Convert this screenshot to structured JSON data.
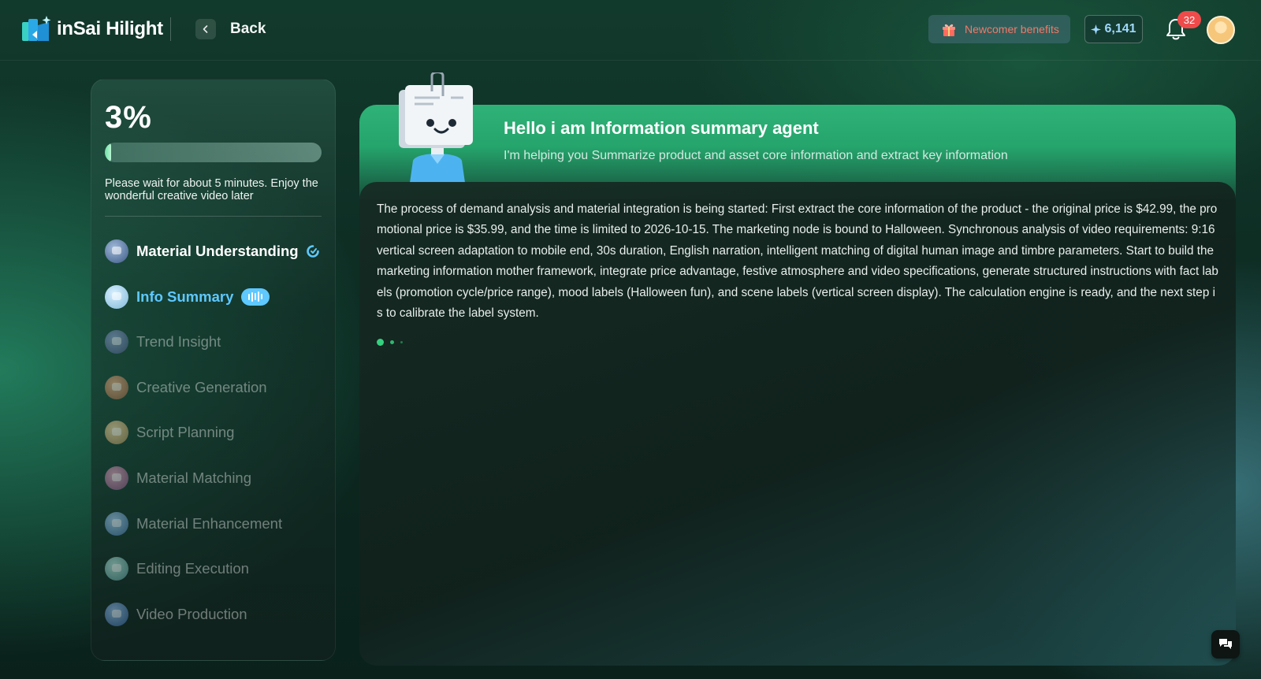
{
  "header": {
    "app_name": "inSai Hilight",
    "back_label": "Back",
    "newcomer_label": "Newcomer benefits",
    "credits": "6,141",
    "notification_count": "32"
  },
  "sidebar": {
    "progress_text": "3%",
    "progress_fraction": 0.03,
    "wait_text": "Please wait for about 5 minutes. Enjoy the wonderful creative video later",
    "steps": [
      {
        "label": "Material Understanding",
        "status": "done"
      },
      {
        "label": "Info Summary",
        "status": "active"
      },
      {
        "label": "Trend Insight",
        "status": "pending"
      },
      {
        "label": "Creative Generation",
        "status": "pending"
      },
      {
        "label": "Script Planning",
        "status": "pending"
      },
      {
        "label": "Material Matching",
        "status": "pending"
      },
      {
        "label": "Material Enhancement",
        "status": "pending"
      },
      {
        "label": "Editing Execution",
        "status": "pending"
      },
      {
        "label": "Video Production",
        "status": "pending"
      }
    ]
  },
  "agent": {
    "title": "Hello i am Information summary agent",
    "subtitle": "I'm helping you Summarize product and asset core information and extract key information"
  },
  "content": {
    "text": "The process of demand analysis and material integration is being started: First extract the core information of the product - the original price is $42.99, the promotional price is $35.99, and the time is limited to 2026-10-15. The marketing node is bound to Halloween. Synchronous analysis of video requirements: 9:16 vertical screen adaptation to mobile end, 30s duration, English narration, intelligent matching of digital human image and timbre parameters. Start to build the marketing information mother framework, integrate price advantage, festive atmosphere and video specifications, generate structured instructions with fact labels (promotion cycle/price range), mood labels (Halloween fun), and scene labels (vertical screen display). The calculation engine is ready, and the next step is to calibrate the label system."
  },
  "colors": {
    "accent_green": "#2fb277",
    "active_blue": "#5ec8ff",
    "badge_red": "#f04b4b",
    "newcomer_text": "#f07a6a"
  },
  "icons": [
    "logo-icon",
    "chevron-left-icon",
    "gift-icon",
    "sparkle-icon",
    "bell-icon",
    "check-icon",
    "audio-wave-icon",
    "chat-icon"
  ]
}
